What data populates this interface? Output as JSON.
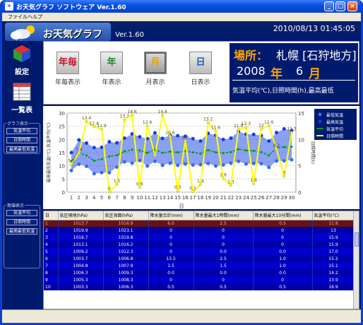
{
  "window": {
    "title": "お天気グラフ ソフトウェア Ver.1.60"
  },
  "menu": [
    "ファイル",
    "ヘルプ"
  ],
  "header": {
    "logo": "お天気グラフ",
    "version": "Ver.1.60",
    "datetime": "2010/08/13 01:45:05"
  },
  "left": {
    "settings": "設定",
    "list": "一覧表",
    "graph_group": "グラフ表示",
    "graph_items": [
      "気温平均",
      "日照時間",
      "最高最低気温"
    ],
    "period_group": "期値表示",
    "period_items": [
      "気温平均",
      "日照時間",
      "最高最低気温"
    ]
  },
  "periods": [
    {
      "icon": "年毎",
      "label": "年毎表示",
      "color": "#c8102e"
    },
    {
      "icon": "年",
      "label": "年表示",
      "color": "#1a8a2a"
    },
    {
      "icon": "月",
      "label": "月表示",
      "color": "#e8a000"
    },
    {
      "icon": "日",
      "label": "日表示",
      "color": "#1e5fc8"
    }
  ],
  "info": {
    "place_label": "場所：",
    "place": "札幌 [石狩地方]",
    "year": "2008",
    "year_unit": "年",
    "month": "6",
    "month_unit": "月",
    "desc": "気温平均(℃),日照時間(h),最高最低"
  },
  "chart_data": {
    "type": "line",
    "x": [
      1,
      2,
      3,
      4,
      5,
      6,
      7,
      8,
      9,
      10,
      11,
      12,
      13,
      14,
      15,
      16,
      17,
      18,
      19,
      20,
      21,
      22,
      23,
      24,
      25,
      26,
      27,
      28,
      29,
      30
    ],
    "xlabel": "日",
    "ylabel": "最高最低気温(℃),気温平均(℃)",
    "y2label": "日照時間(h)",
    "ylim": [
      0,
      30
    ],
    "y2lim": [
      0,
      15
    ],
    "yticks": [
      0,
      5,
      10,
      15,
      20,
      25,
      30
    ],
    "y2ticks": [
      0,
      5,
      10,
      15
    ],
    "legend": [
      "最低気温",
      "最高気温",
      "気温平均",
      "日照時間"
    ],
    "series": [
      {
        "name": "気温平均",
        "values": [
          11.8,
          14.8,
          13.9,
          11.9,
          12.5,
          13.6,
          14.0,
          15.5,
          16.1,
          15.8,
          14.9,
          16.3,
          14.9,
          15.4,
          15.1,
          15.6,
          15.1,
          14.6,
          16.0,
          15.1,
          14.8,
          15.2,
          16.3,
          15.8,
          15.7,
          15.2,
          13.9,
          16.8,
          17.1,
          17.2
        ]
      },
      {
        "name": "日照時間",
        "values": [
          5.3,
          7.4,
          13.4,
          12.4,
          11.9,
          0.0,
          1.5,
          13.7,
          14.6,
          0.9,
          12.6,
          7.0,
          14.6,
          10.6,
          0.3,
          9.7,
          0.1,
          1.4,
          13.2,
          11.6,
          2.6,
          1.3,
          11.9,
          12.3,
          1.6,
          12.0,
          12.6,
          8.2,
          3.0,
          11.3
        ]
      },
      {
        "name": "最高気温",
        "values": [
          15.0,
          19.8,
          18.6,
          16.9,
          17.0,
          19.1,
          18.7,
          20.5,
          22.1,
          21.0,
          20.3,
          22.5,
          20.4,
          21.6,
          21.4,
          21.2,
          20.3,
          19.4,
          22.3,
          21.6,
          20.0,
          20.5,
          23.0,
          22.0,
          21.9,
          21.5,
          19.4,
          22.6,
          24.0,
          23.4
        ]
      },
      {
        "name": "最低気温",
        "values": [
          8.2,
          10.6,
          9.8,
          7.0,
          7.4,
          7.4,
          9.5,
          11.5,
          11.0,
          12.0,
          9.9,
          11.7,
          10.2,
          11.0,
          10.2,
          10.7,
          10.3,
          10.4,
          10.9,
          9.9,
          10.3,
          11.0,
          11.7,
          10.7,
          10.9,
          10.8,
          9.4,
          11.8,
          11.9,
          12.3
        ]
      }
    ],
    "labels_sun": [
      "5.3",
      "7.4",
      "13.4",
      "12.4",
      "11.9",
      "0",
      "1.5",
      "13.7",
      "14.6",
      "0.9",
      "12.6",
      "7",
      "14.6",
      "10.6",
      "0.3",
      "9.7",
      "0.1",
      "1.4",
      "13.2",
      "11.6",
      "2.6",
      "1.3",
      "11.9",
      "12.3",
      "1.6",
      "12",
      "12.6",
      "8.2",
      "3",
      "11.3"
    ],
    "colors": {
      "avg": "#009900",
      "sun": "#ffff00",
      "band": "#1a3adf"
    }
  },
  "table": {
    "columns": [
      "日",
      "気圧現地(hPa)",
      "気圧海面(hPa)",
      "降水量合計(mm)",
      "降水量最大1時間(mm)",
      "降水量最大10分間(mm)",
      "気温平均(℃)"
    ],
    "rows": [
      [
        "1",
        "1013.7",
        "1016.9",
        "6.0",
        "2.5",
        "0.5",
        "11.8"
      ],
      [
        "2",
        "1019.9",
        "1023.1",
        "0",
        "0",
        "0",
        "13"
      ],
      [
        "3",
        "1016.7",
        "1019.8",
        "0",
        "0",
        "0",
        "15.9"
      ],
      [
        "4",
        "1013.1",
        "1016.2",
        "0",
        "0",
        "0",
        "15.9"
      ],
      [
        "5",
        "1009.2",
        "1012.3",
        "0",
        "0.0",
        "0.0",
        "17.0"
      ],
      [
        "6",
        "1003.7",
        "1006.8",
        "13.5",
        "2.5",
        "1.0",
        "15.2"
      ],
      [
        "7",
        "1004.8",
        "1007.9",
        "1.5",
        "1.5",
        "1.0",
        "15.1"
      ],
      [
        "8",
        "1006.3",
        "1009.3",
        "0.0",
        "0.0",
        "0.0",
        "14.2"
      ],
      [
        "9",
        "1005.3",
        "1008.3",
        "0",
        "0",
        "0",
        "13.9"
      ],
      [
        "10",
        "1003.3",
        "1006.3",
        "0.5",
        "0.5",
        "0.5",
        "16.9"
      ]
    ]
  }
}
